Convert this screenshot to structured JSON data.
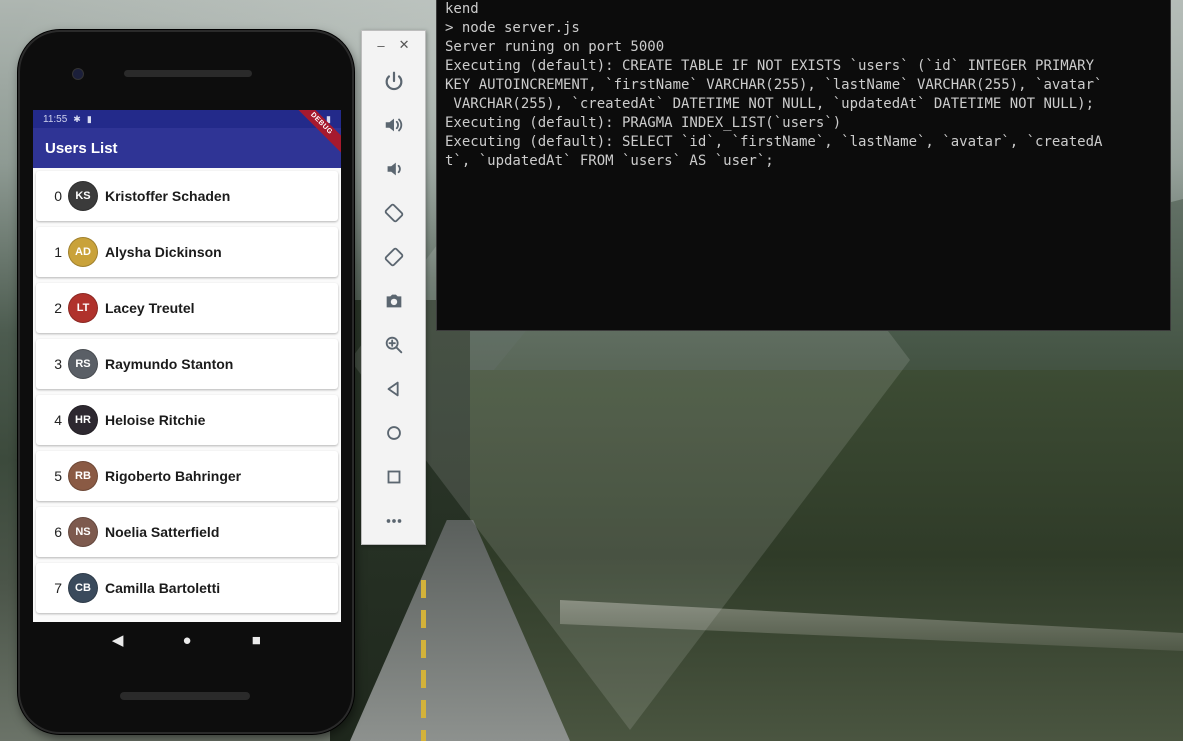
{
  "terminal": {
    "lines": [
      "kend",
      "> node server.js",
      "",
      "",
      "Server runing on port 5000",
      "Executing (default): CREATE TABLE IF NOT EXISTS `users` (`id` INTEGER PRIMARY",
      "KEY AUTOINCREMENT, `firstName` VARCHAR(255), `lastName` VARCHAR(255), `avatar`",
      " VARCHAR(255), `createdAt` DATETIME NOT NULL, `updatedAt` DATETIME NOT NULL);",
      "Executing (default): PRAGMA INDEX_LIST(`users`)",
      "Executing (default): SELECT `id`, `firstName`, `lastName`, `avatar`, `createdA",
      "t`, `updatedAt` FROM `users` AS `user`;"
    ]
  },
  "phone": {
    "status_bar": {
      "time": "11:55",
      "icons": [
        "settings-icon",
        "sim-icon",
        "wifi-icon",
        "battery-icon"
      ]
    },
    "debug_banner": "DEBUG",
    "app_bar_title": "Users List",
    "users": [
      {
        "index": "0",
        "name": "Kristoffer Schaden",
        "avatar_color": "#3b3b3b"
      },
      {
        "index": "1",
        "name": "Alysha Dickinson",
        "avatar_color": "#c9a23a"
      },
      {
        "index": "2",
        "name": "Lacey Treutel",
        "avatar_color": "#b0322c"
      },
      {
        "index": "3",
        "name": "Raymundo Stanton",
        "avatar_color": "#5a5f66"
      },
      {
        "index": "4",
        "name": "Heloise Ritchie",
        "avatar_color": "#2d2830"
      },
      {
        "index": "5",
        "name": "Rigoberto Bahringer",
        "avatar_color": "#8a5a44"
      },
      {
        "index": "6",
        "name": "Noelia Satterfield",
        "avatar_color": "#7d5a4e"
      },
      {
        "index": "7",
        "name": "Camilla Bartoletti",
        "avatar_color": "#3a4a5c"
      }
    ],
    "nav": {
      "back": "back-icon",
      "home": "home-icon",
      "recents": "recents-icon"
    }
  },
  "emulator_toolbar": {
    "window_controls": {
      "minimize": "–",
      "close": "✕"
    },
    "buttons": [
      "power-icon",
      "volume-up-icon",
      "volume-down-icon",
      "rotate-left-icon",
      "rotate-right-icon",
      "camera-icon",
      "zoom-icon",
      "back-icon",
      "home-icon",
      "overview-icon",
      "more-icon"
    ]
  }
}
